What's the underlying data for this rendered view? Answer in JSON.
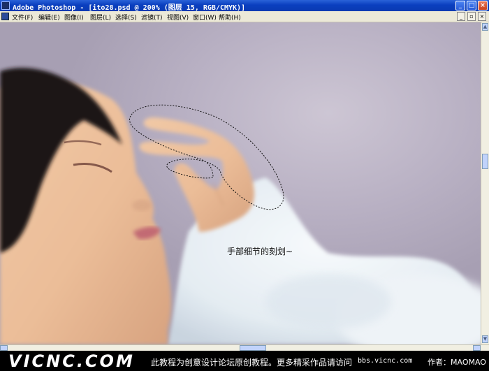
{
  "window": {
    "title": "Adobe Photoshop - [ito28.psd @ 200% (图层 15, RGB/CMYK)]",
    "buttons": {
      "minimize": "_",
      "maximize": "□",
      "close": "×"
    }
  },
  "menu": {
    "items": [
      "文件(F)",
      "编辑(E)",
      "图像(I)",
      "图层(L)",
      "选择(S)",
      "滤镜(T)",
      "视图(V)",
      "窗口(W)",
      "帮助(H)"
    ],
    "doc_buttons": {
      "minimize": "_",
      "restore": "▫",
      "close": "×"
    }
  },
  "canvas": {
    "caption": "手部细节的刻划~"
  },
  "scrollbars": {
    "up": "▲",
    "down": "▼"
  },
  "footer": {
    "logo": "VICNC.COM",
    "notice": "此教程为创意设计论坛原创教程。更多精采作品请访问",
    "site": "bbs.vicnc.com",
    "author": "作者：MAOMAO"
  },
  "colors": {
    "titlebar": "#0a3fbf",
    "menubar": "#ece9d8",
    "background": "#b8b0c3",
    "footer": "#000000"
  }
}
